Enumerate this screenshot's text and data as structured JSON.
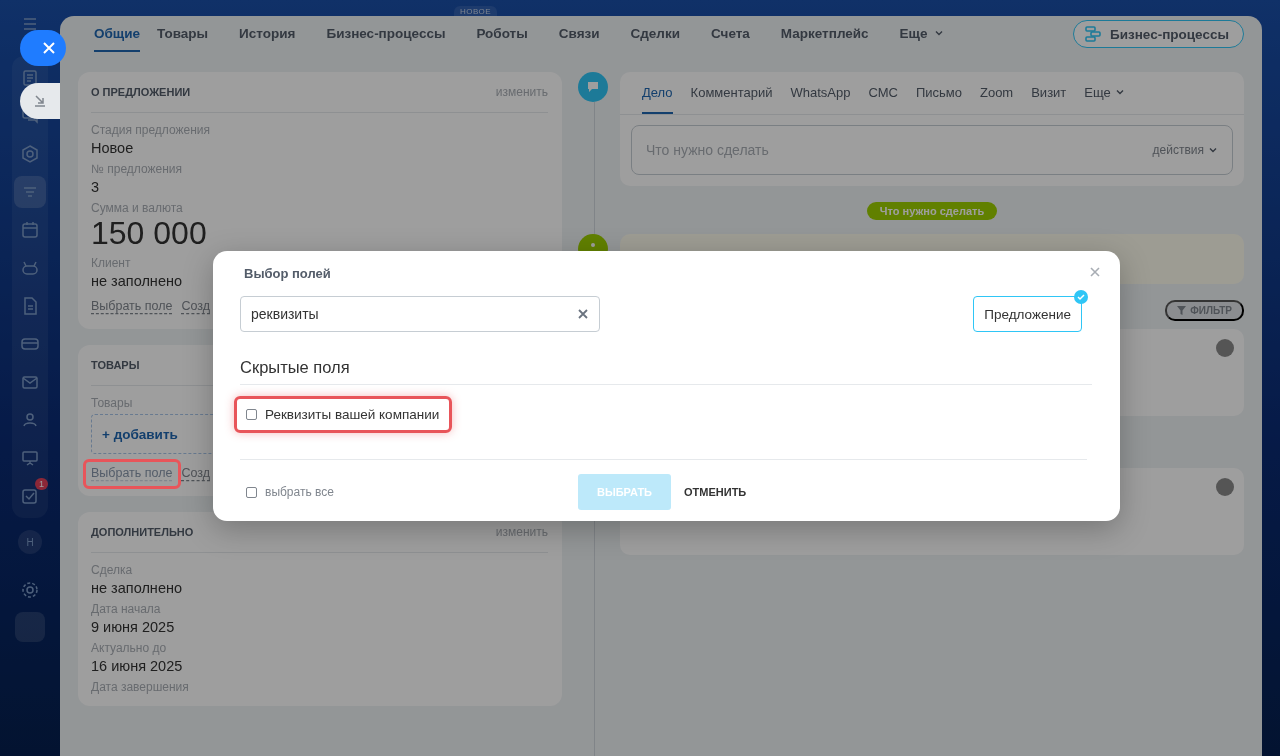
{
  "sidebar": {
    "tasks_badge": "1",
    "avatar": "Н"
  },
  "top_badge": "НОВОЕ",
  "tabs": [
    {
      "label": "Общие",
      "selected": true
    },
    {
      "label": "Товары",
      "selected": false
    },
    {
      "label": "История",
      "selected": false
    },
    {
      "label": "Бизнес-процессы",
      "selected": false
    },
    {
      "label": "Роботы",
      "selected": false
    },
    {
      "label": "Связи",
      "selected": false
    },
    {
      "label": "Сделки",
      "selected": false
    },
    {
      "label": "Счета",
      "selected": false
    },
    {
      "label": "Маркетплейс",
      "selected": false
    }
  ],
  "tabs_more": "Еще",
  "bp_button": "Бизнес-процессы",
  "cards": [
    {
      "title": "О ПРЕДЛОЖЕНИИ",
      "edit": "изменить",
      "fields": [
        {
          "label": "Стадия предложения",
          "value": "Новое",
          "kind": "text"
        },
        {
          "label": "№ предложения",
          "value": "3",
          "kind": "text"
        },
        {
          "label": "Сумма и валюта",
          "value": "150 000",
          "kind": "amount"
        },
        {
          "label": "Клиент",
          "value": "не заполнено",
          "kind": "text"
        }
      ],
      "links": [
        {
          "text": "Выбрать поле",
          "highlighted": false
        },
        {
          "text": "Созд",
          "highlighted": false
        }
      ]
    },
    {
      "title": "ТОВАРЫ",
      "fields": [
        {
          "label": "Товары",
          "value": "+ добавить",
          "kind": "add"
        }
      ],
      "links": [
        {
          "text": "Выбрать поле",
          "highlighted": true
        },
        {
          "text": "Созд",
          "highlighted": false
        }
      ]
    },
    {
      "title": "ДОПОЛНИТЕЛЬНО",
      "edit": "изменить",
      "fields": [
        {
          "label": "Сделка",
          "value": "не заполнено",
          "kind": "text"
        },
        {
          "label": "Дата начала",
          "value": "9 июня 2025",
          "kind": "text"
        },
        {
          "label": "Актуально до",
          "value": "16 июня 2025",
          "kind": "text"
        },
        {
          "label": "Дата завершения",
          "kind": "text"
        }
      ]
    }
  ],
  "activity": {
    "tabs": [
      {
        "label": "Дело",
        "selected": true
      },
      {
        "label": "Комментарий",
        "selected": false
      },
      {
        "label": "WhatsApp",
        "selected": false
      },
      {
        "label": "СМС",
        "selected": false
      },
      {
        "label": "Письмо",
        "selected": false
      },
      {
        "label": "Zoom",
        "selected": false
      },
      {
        "label": "Визит",
        "selected": false
      }
    ],
    "more": "Еще",
    "placeholder": "Что нужно сделать",
    "actions": "действия"
  },
  "todo_pill": "Что нужно сделать",
  "filter": "ФИЛЬТР",
  "dialog": {
    "title": "Выбор полей",
    "search": "реквизиты",
    "chips": [
      {
        "label": "Предложение",
        "selected": true
      }
    ],
    "section": "Скрытые поля",
    "items": [
      {
        "label": "Реквизиты вашей компании",
        "checked": false,
        "highlighted": true
      }
    ],
    "select_all": {
      "label": "выбрать все",
      "checked": false
    },
    "buttons": [
      {
        "label": "ВЫБРАТЬ",
        "kind": "primary",
        "disabled": true
      },
      {
        "label": "ОТМЕНИТЬ",
        "kind": "link",
        "disabled": false
      }
    ]
  }
}
